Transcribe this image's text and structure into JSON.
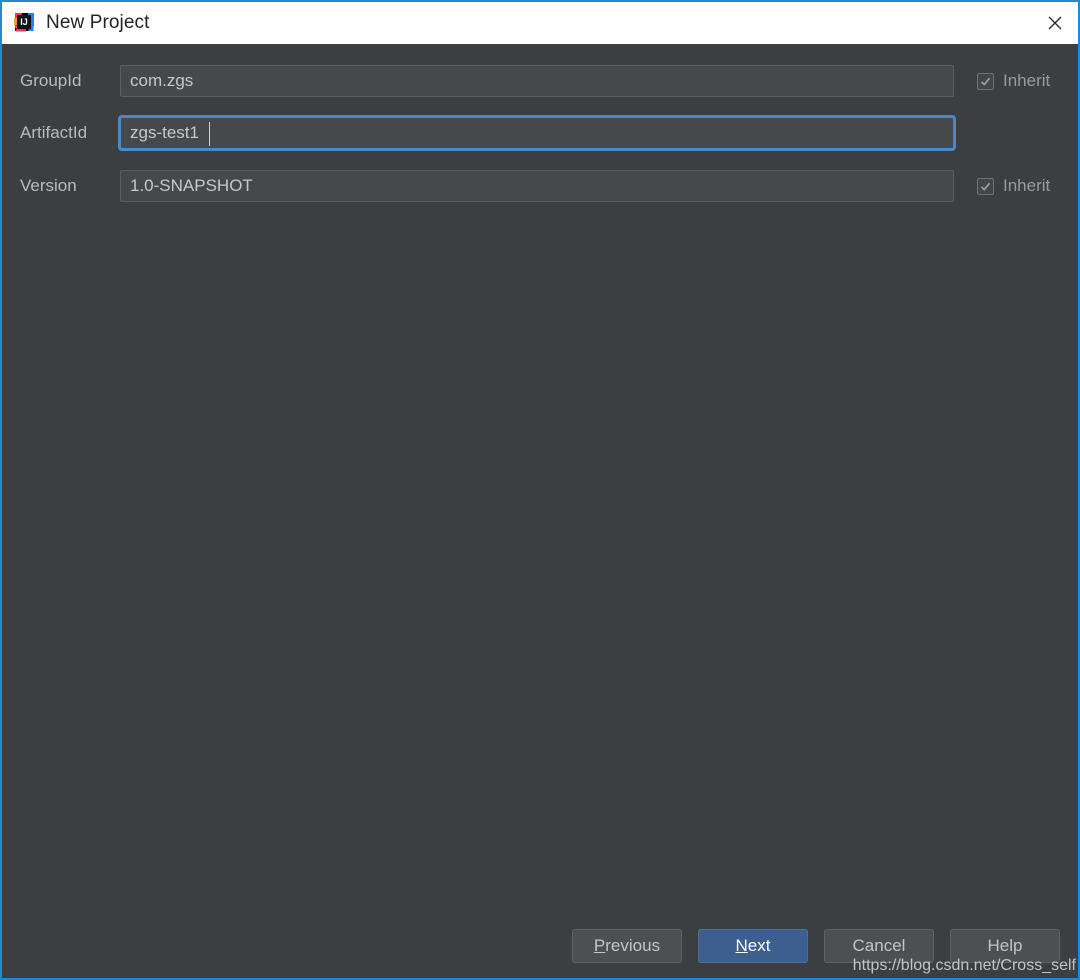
{
  "window": {
    "title": "New Project",
    "icon": "intellij-idea-icon",
    "close_label": "close-icon",
    "border_color": "#1e8ad6",
    "titlebar_bg": "#ffffff",
    "body_bg": "#3c3f41"
  },
  "form": {
    "fields": [
      {
        "label": "GroupId",
        "value": "com.zgs",
        "focused": false,
        "inherit": {
          "label": "Inherit",
          "checked": true,
          "enabled": false
        }
      },
      {
        "label": "ArtifactId",
        "value": "zgs-test1",
        "focused": true,
        "inherit": null
      },
      {
        "label": "Version",
        "value": "1.0-SNAPSHOT",
        "focused": false,
        "inherit": {
          "label": "Inherit",
          "checked": true,
          "enabled": false
        }
      }
    ]
  },
  "footer": {
    "previous": {
      "label": "Previous",
      "mnemonic": "P",
      "rest": "revious"
    },
    "next": {
      "label": "Next",
      "mnemonic": "N",
      "rest": "ext",
      "primary": true,
      "color": "#3c5f8f"
    },
    "cancel": {
      "label": "Cancel"
    },
    "help": {
      "label": "Help"
    }
  },
  "watermark": {
    "text": "https://blog.csdn.net/Cross_self"
  }
}
